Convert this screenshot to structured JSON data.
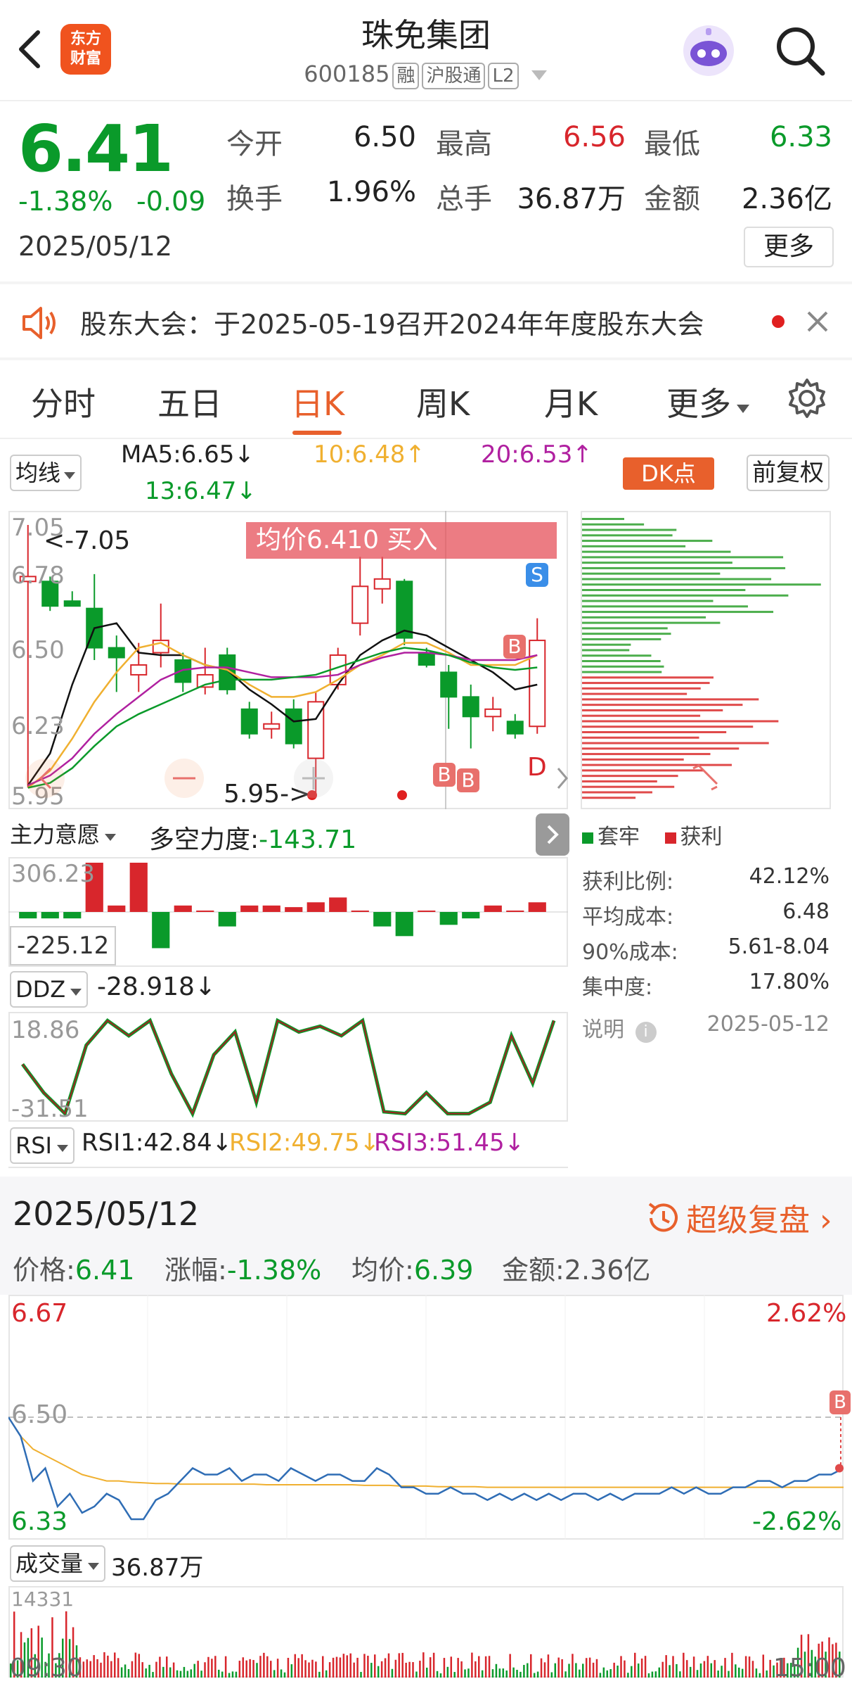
{
  "header": {
    "logo_text": "东方财富",
    "title": "珠免集团",
    "code": "600185",
    "tags": [
      "融",
      "沪股通",
      "L2"
    ]
  },
  "quote": {
    "price": "6.41",
    "change_pct": "-1.38%",
    "change": "-0.09",
    "date": "2025/05/12",
    "fields": [
      {
        "label": "今开",
        "value": "6.50",
        "color": "#222222"
      },
      {
        "label": "最高",
        "value": "6.56",
        "color": "#d8262c"
      },
      {
        "label": "最低",
        "value": "6.33",
        "color": "#0a9a2a"
      },
      {
        "label": "换手",
        "value": "1.96%",
        "color": "#222222"
      },
      {
        "label": "总手",
        "value": "36.87万",
        "color": "#222222"
      },
      {
        "label": "金额",
        "value": "2.36亿",
        "color": "#222222"
      }
    ],
    "more_label": "更多"
  },
  "notice": {
    "text": "股东大会：于2025-05-19召开2024年年度股东大会"
  },
  "tabs": [
    {
      "label": "分时",
      "active": false
    },
    {
      "label": "五日",
      "active": false
    },
    {
      "label": "日K",
      "active": true
    },
    {
      "label": "周K",
      "active": false
    },
    {
      "label": "月K",
      "active": false
    },
    {
      "label": "更多",
      "active": false
    }
  ],
  "kline": {
    "ma_selector": "均线",
    "ma5": "MA5:6.65↓",
    "ma10": "10:6.48↑",
    "ma20": "20:6.53↑",
    "ma13": "13:6.47↓",
    "dk_label": "DK点",
    "adjust_label": "前复权",
    "y_labels": [
      "7.05",
      "6.78",
      "6.50",
      "6.23",
      "5.95"
    ],
    "high_marker": "<-7.05",
    "low_marker": "5.95->",
    "avg_buy_banner": "均价6.410  买入",
    "d_marker": "D",
    "s_marker": "S",
    "b_marker": "B",
    "colors": {
      "up": "#d8262c",
      "down": "#0a9a2a",
      "ma5": "#111111",
      "ma10": "#f0b030",
      "ma20": "#b020a0",
      "ma13": "#0a9a2a"
    },
    "candles": [
      {
        "o": 6.82,
        "c": 6.84,
        "h": 7.05,
        "l": 5.98
      },
      {
        "o": 6.82,
        "c": 6.72,
        "h": 6.84,
        "l": 6.7
      },
      {
        "o": 6.74,
        "c": 6.72,
        "h": 6.78,
        "l": 6.72
      },
      {
        "o": 6.71,
        "c": 6.55,
        "h": 6.85,
        "l": 6.5
      },
      {
        "o": 6.55,
        "c": 6.51,
        "h": 6.6,
        "l": 6.37
      },
      {
        "o": 6.44,
        "c": 6.48,
        "h": 6.57,
        "l": 6.37
      },
      {
        "o": 6.53,
        "c": 6.58,
        "h": 6.73,
        "l": 6.47
      },
      {
        "o": 6.5,
        "c": 6.41,
        "h": 6.53,
        "l": 6.37
      },
      {
        "o": 6.39,
        "c": 6.44,
        "h": 6.55,
        "l": 6.36
      },
      {
        "o": 6.52,
        "c": 6.38,
        "h": 6.55,
        "l": 6.36
      },
      {
        "o": 6.3,
        "c": 6.2,
        "h": 6.33,
        "l": 6.18
      },
      {
        "o": 6.22,
        "c": 6.24,
        "h": 6.29,
        "l": 6.18
      },
      {
        "o": 6.3,
        "c": 6.16,
        "h": 6.34,
        "l": 6.14
      },
      {
        "o": 6.1,
        "c": 6.33,
        "h": 6.37,
        "l": 5.95
      },
      {
        "o": 6.4,
        "c": 6.52,
        "h": 6.55,
        "l": 6.38
      },
      {
        "o": 6.65,
        "c": 6.8,
        "h": 6.92,
        "l": 6.6
      },
      {
        "o": 6.79,
        "c": 6.83,
        "h": 6.92,
        "l": 6.73
      },
      {
        "o": 6.82,
        "c": 6.59,
        "h": 6.83,
        "l": 6.56
      },
      {
        "o": 6.53,
        "c": 6.48,
        "h": 6.55,
        "l": 6.47
      },
      {
        "o": 6.45,
        "c": 6.35,
        "h": 6.48,
        "l": 6.22
      },
      {
        "o": 6.35,
        "c": 6.27,
        "h": 6.4,
        "l": 6.14
      },
      {
        "o": 6.27,
        "c": 6.3,
        "h": 6.35,
        "l": 6.21
      },
      {
        "o": 6.25,
        "c": 6.2,
        "h": 6.28,
        "l": 6.18
      },
      {
        "o": 6.23,
        "c": 6.58,
        "h": 6.67,
        "l": 6.2
      }
    ],
    "ma5_series": [
      5.99,
      6.12,
      6.4,
      6.63,
      6.65,
      6.53,
      6.52,
      6.52,
      6.48,
      6.46,
      6.38,
      6.32,
      6.25,
      6.26,
      6.4,
      6.52,
      6.58,
      6.62,
      6.6,
      6.55,
      6.5,
      6.45,
      6.38,
      6.4
    ],
    "ma10_series": [
      5.98,
      6.05,
      6.18,
      6.33,
      6.45,
      6.55,
      6.57,
      6.52,
      6.48,
      6.46,
      6.4,
      6.35,
      6.35,
      6.37,
      6.42,
      6.48,
      6.52,
      6.57,
      6.57,
      6.53,
      6.48,
      6.48,
      6.48,
      6.52
    ],
    "ma20_series": [
      5.99,
      6.03,
      6.1,
      6.2,
      6.28,
      6.35,
      6.42,
      6.46,
      6.47,
      6.47,
      6.45,
      6.43,
      6.43,
      6.43,
      6.44,
      6.48,
      6.51,
      6.53,
      6.53,
      6.52,
      6.5,
      6.5,
      6.5,
      6.52
    ],
    "ma13_series": [
      5.98,
      6.0,
      6.06,
      6.15,
      6.23,
      6.28,
      6.32,
      6.36,
      6.4,
      6.42,
      6.42,
      6.42,
      6.43,
      6.44,
      6.47,
      6.5,
      6.53,
      6.55,
      6.54,
      6.52,
      6.49,
      6.47,
      6.46,
      6.47
    ]
  },
  "chip": {
    "legend_trapped": "套牢",
    "legend_profit": "获利",
    "stats": [
      {
        "label": "获利比例:",
        "value": "42.12%"
      },
      {
        "label": "平均成本:",
        "value": "6.48"
      },
      {
        "label": "90%成本:",
        "value": "5.61-8.04"
      },
      {
        "label": "集中度:",
        "value": "17.80%"
      }
    ],
    "note_label": "说明",
    "note_date": "2025-05-12"
  },
  "zlyy": {
    "selector": "主力意愿",
    "label": "多空力度:",
    "value": "-143.71",
    "max": "306.23",
    "min": "-225.12",
    "bars": [
      -40,
      -40,
      -40,
      306,
      40,
      306,
      -225,
      40,
      0,
      -90,
      40,
      40,
      30,
      60,
      90,
      0,
      -90,
      -150,
      0,
      -80,
      -40,
      40,
      0,
      60
    ]
  },
  "ddz": {
    "selector": "DDZ",
    "value": "-28.918↓",
    "max": "18.86",
    "min": "-31.51",
    "series": [
      -5,
      -20,
      -31,
      5,
      18,
      10,
      18,
      -10,
      -31,
      0,
      12,
      -25,
      18,
      12,
      15,
      10,
      18,
      -30,
      -31,
      -20,
      -31,
      -31,
      -25,
      10,
      -15,
      18
    ]
  },
  "rsi": {
    "selector": "RSI",
    "rsi1": "RSI1:42.84↓",
    "rsi2": "RSI2:49.75↓",
    "rsi3": "RSI3:51.45↓"
  },
  "summary": {
    "date": "2025/05/12",
    "fupan_label": "超级复盘",
    "price": "价格:6.41",
    "change": "涨幅:-1.38%",
    "avg": "均价:6.39",
    "amount": "金额:2.36亿"
  },
  "intraday": {
    "y_top": "6.67",
    "y_ref": "6.50",
    "y_bottom": "6.33",
    "pct_top": "2.62%",
    "pct_bottom": "-2.62%",
    "price_series": [
      6.5,
      6.47,
      6.4,
      6.42,
      6.36,
      6.38,
      6.35,
      6.36,
      6.38,
      6.37,
      6.34,
      6.34,
      6.37,
      6.38,
      6.4,
      6.42,
      6.41,
      6.41,
      6.42,
      6.4,
      6.41,
      6.41,
      6.4,
      6.42,
      6.41,
      6.4,
      6.41,
      6.41,
      6.4,
      6.4,
      6.42,
      6.41,
      6.39,
      6.39,
      6.38,
      6.38,
      6.39,
      6.38,
      6.38,
      6.37,
      6.38,
      6.37,
      6.38,
      6.37,
      6.38,
      6.37,
      6.38,
      6.38,
      6.37,
      6.38,
      6.37,
      6.38,
      6.38,
      6.38,
      6.39,
      6.38,
      6.39,
      6.38,
      6.38,
      6.39,
      6.39,
      6.4,
      6.4,
      6.39,
      6.4,
      6.4,
      6.41,
      6.41,
      6.42
    ],
    "avg_series": [
      6.5,
      6.47,
      6.45,
      6.44,
      6.43,
      6.42,
      6.41,
      6.405,
      6.4,
      6.4,
      6.398,
      6.397,
      6.396,
      6.396,
      6.395,
      6.395,
      6.395,
      6.395,
      6.395,
      6.395,
      6.395,
      6.394,
      6.394,
      6.394,
      6.394,
      6.394,
      6.394,
      6.394,
      6.394,
      6.393,
      6.393,
      6.393,
      6.392,
      6.392,
      6.392,
      6.391,
      6.391,
      6.391,
      6.391,
      6.39,
      6.39,
      6.39,
      6.39,
      6.39,
      6.39,
      6.39,
      6.39,
      6.39,
      6.39,
      6.39,
      6.39,
      6.39,
      6.39,
      6.39,
      6.39,
      6.39,
      6.39,
      6.39,
      6.39,
      6.39,
      6.39,
      6.39,
      6.39,
      6.39,
      6.39,
      6.39,
      6.39,
      6.39,
      6.39
    ],
    "colors": {
      "price": "#2f6db5",
      "avg": "#f0b030"
    }
  },
  "volume": {
    "selector": "成交量",
    "value": "36.87万",
    "max_label": "14331",
    "time_start": "09:30",
    "time_end": "15:00"
  }
}
